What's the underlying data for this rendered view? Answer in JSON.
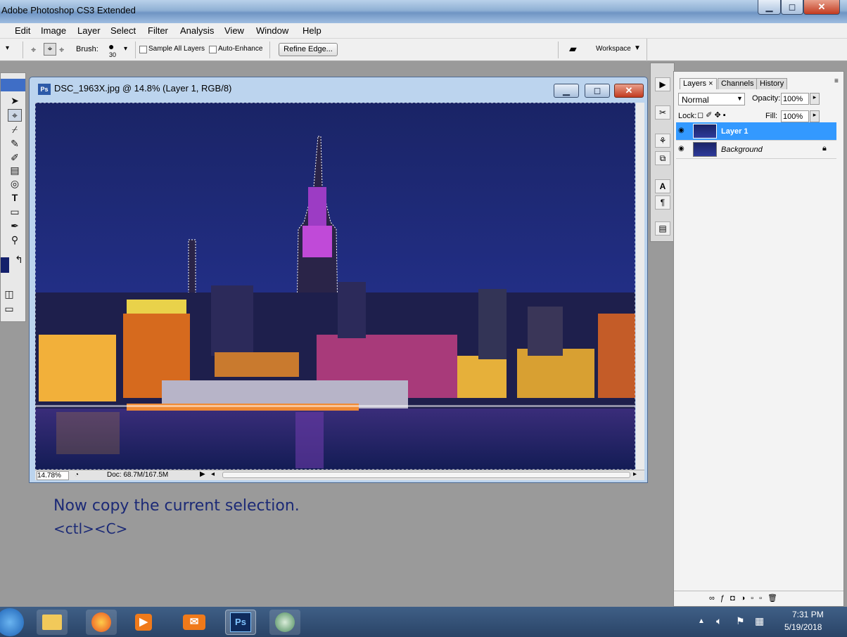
{
  "app": {
    "title": "Adobe Photoshop CS3 Extended"
  },
  "menu": [
    "Edit",
    "Image",
    "Layer",
    "Select",
    "Filter",
    "Analysis",
    "View",
    "Window",
    "Help"
  ],
  "options": {
    "brush_label": "Brush:",
    "brush_size": "30",
    "sample_all_layers": "Sample All Layers",
    "auto_enhance": "Auto-Enhance",
    "refine_edge": "Refine Edge...",
    "workspace": "Workspace"
  },
  "document": {
    "title": "DSC_1963X.jpg @ 14.8% (Layer 1, RGB/8)",
    "zoom": "14.78%",
    "doc_size": "Doc: 68.7M/167.5M"
  },
  "instruction": {
    "line1": "Now copy the current selection.",
    "line2": "<ctl><C>"
  },
  "layers_panel": {
    "tabs": [
      "Layers",
      "Channels",
      "History"
    ],
    "blend_mode": "Normal",
    "opacity_label": "Opacity:",
    "opacity": "100%",
    "lock_label": "Lock:",
    "fill_label": "Fill:",
    "fill": "100%",
    "layers": [
      {
        "name": "Layer 1",
        "selected": true
      },
      {
        "name": "Background",
        "selected": false,
        "locked": true
      }
    ]
  },
  "taskbar": {
    "apps": [
      "windows-start",
      "file-explorer",
      "firefox",
      "media-player",
      "mail",
      "photoshop",
      "network"
    ],
    "ps_label": "Ps",
    "time": "7:31 PM",
    "date": "5/19/2018"
  },
  "colors": {
    "selection_blue": "#3399ff",
    "title_blue": "#6f95c4",
    "instruction_text": "#1c2a76"
  }
}
